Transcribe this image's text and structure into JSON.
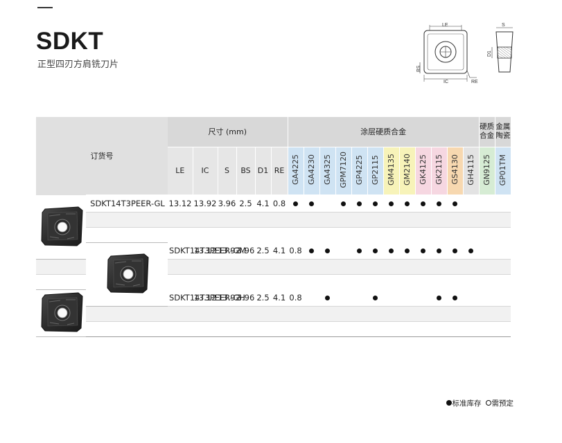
{
  "header": {
    "title": "SDKT",
    "subtitle": "正型四刃方肩铣刀片"
  },
  "diagram": {
    "labels": {
      "le": "LE",
      "s": "S",
      "d1": "D1",
      "bs": "BS",
      "ic": "IC",
      "re": "RE"
    }
  },
  "table": {
    "order_header": "订货号",
    "dims_header": "尺寸 (mm)",
    "coated_header": "涂层硬质合金",
    "carbide_header": "硬质合金",
    "cermet_header": "金属陶瓷",
    "dim_columns": [
      "LE",
      "IC",
      "S",
      "BS",
      "D1",
      "RE"
    ],
    "grades": [
      "GA4225",
      "GA4230",
      "GA4325",
      "GPM7120",
      "GP4225",
      "GP2115",
      "GM4135",
      "GM2140",
      "GK4125",
      "GK2115",
      "GS4130",
      "GH4115",
      "GN9125",
      "GP01TM"
    ],
    "grade_colors": {
      "GA4225": "#cfe3f3",
      "GA4230": "#cfe3f3",
      "GA4325": "#cfe3f3",
      "GPM7120": "#cfe3f3",
      "GP4225": "#cfe3f3",
      "GP2115": "#cfe3f3",
      "GM4135": "#f7f3b9",
      "GM2140": "#f7f3b9",
      "GK4125": "#f6d7e1",
      "GK2115": "#f6d7e1",
      "GS4130": "#f7d8b0",
      "GH4115": "#e3e3e3",
      "GN9125": "#d6ecd4",
      "GP01TM": "#cfe3f3"
    },
    "rows": [
      {
        "code": "SDKT14T3PEER-GL",
        "dims": [
          "13.12",
          "13.92",
          "3.96",
          "2.5",
          "4.1",
          "0.8"
        ],
        "stock": [
          true,
          true,
          false,
          true,
          true,
          true,
          true,
          true,
          true,
          true,
          true,
          false,
          false,
          false
        ]
      },
      {
        "code": "SDKT14T3PEER-GM",
        "dims": [
          "13.12",
          "13.92",
          "3.96",
          "2.5",
          "4.1",
          "0.8"
        ],
        "stock": [
          true,
          true,
          false,
          true,
          true,
          true,
          true,
          true,
          true,
          true,
          true,
          false,
          false,
          false
        ]
      },
      {
        "code": "SDKT14T3PEER-GH",
        "dims": [
          "13.12",
          "13.92",
          "3.96",
          "2.5",
          "4.1",
          "0.8"
        ],
        "stock": [
          false,
          true,
          false,
          false,
          true,
          false,
          false,
          false,
          true,
          true,
          false,
          false,
          false,
          false
        ]
      }
    ]
  },
  "legend": {
    "standard_stock": "标准库存",
    "preorder": "需预定"
  }
}
